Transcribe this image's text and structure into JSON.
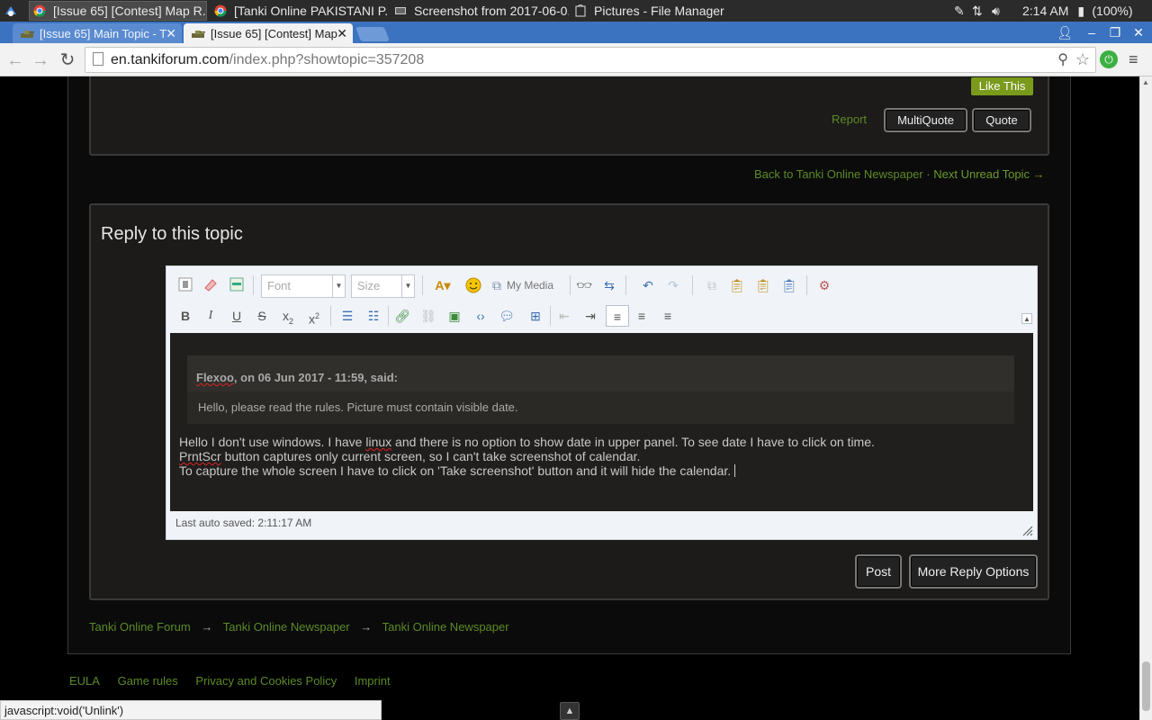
{
  "taskbar": {
    "tasks": [
      "[Issue 65] [Contest] Map R...",
      "[Tanki Online PAKISTANI P...",
      "Screenshot from 2017-06-0...",
      "Pictures - File Manager"
    ],
    "time": "2:14 AM",
    "battery": "(100%)"
  },
  "browser": {
    "tabs": [
      "[Issue 65] Main Topic - T",
      "[Issue 65] [Contest] Map"
    ],
    "url_host": "en.tankiforum.com",
    "url_path": "/index.php?showtopic=357208"
  },
  "post": {
    "like_label": "Like This",
    "report_label": "Report",
    "multiquote_label": "MultiQuote",
    "quote_label": "Quote"
  },
  "topic_nav": {
    "back_label": "Back to Tanki Online Newspaper",
    "separator": "·",
    "next_label": "Next Unread Topic →"
  },
  "reply": {
    "title": "Reply to this topic",
    "font_placeholder": "Font",
    "size_placeholder": "Size",
    "my_media_label": "My Media",
    "quote_author": "Flexoo",
    "quote_meta": ", on 06 Jun 2017 - 11:59, said:",
    "quote_text": "Hello, please read the rules. Picture must contain visible date.",
    "line1_a": "Hello I don't use windows. I have ",
    "line1_b": "linux",
    "line1_c": " and there is no option to show date in upper panel. To see date I have to click on time.",
    "line2_a": "PrntScr",
    "line2_b": " button captures only current screen, so I can't take screenshot of calendar.",
    "line3": "To capture the whole screen I have to click on 'Take screenshot' button and it will hide the calendar.",
    "autosave": "Last auto saved: 2:11:17 AM",
    "post_label": "Post",
    "more_options_label": "More Reply Options"
  },
  "breadcrumb": [
    "Tanki Online Forum",
    "Tanki Online Newspaper",
    "Tanki Online Newspaper"
  ],
  "breadcrumb_arrow": "→",
  "footer": {
    "links": [
      "EULA",
      "Game rules",
      "Privacy and Cookies Policy",
      "Imprint"
    ]
  },
  "status_bar": "javascript:void('Unlink')",
  "colors": {
    "link_green": "#5c8a27",
    "like_green": "#7a9a1c",
    "tab_blue": "#3b73c0"
  }
}
